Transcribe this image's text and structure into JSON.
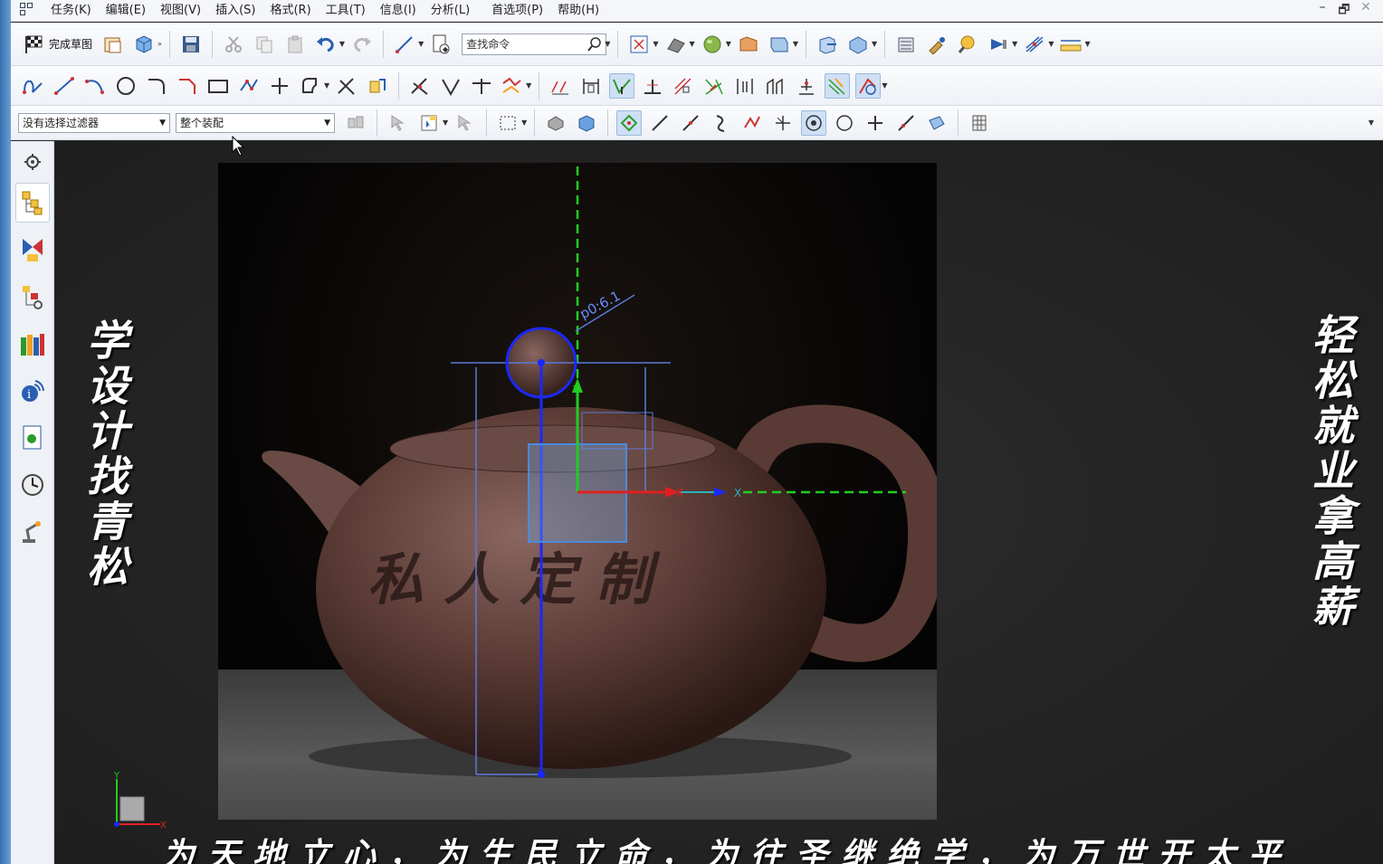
{
  "menu": {
    "items": [
      "任务(K)",
      "编辑(E)",
      "视图(V)",
      "插入(S)",
      "格式(R)",
      "工具(T)",
      "信息(I)",
      "分析(L)",
      "首选项(P)",
      "帮助(H)"
    ]
  },
  "window_controls": {
    "minimize": "–",
    "restore": "🗗",
    "close": "✕"
  },
  "toolbar1": {
    "finish_sketch_label": "完成草图",
    "search_placeholder": "查找命令"
  },
  "toolbar3": {
    "selection_filter": "没有选择过滤器",
    "scope": "整个装配"
  },
  "sketch": {
    "dimension_label": "p0:6.1"
  },
  "overlay_text": {
    "left_vertical": "学设计找青松",
    "right_vertical": "轻松就业拿高薪",
    "bottom_motto": "为天地立心，为生民立命，为往圣继绝学，为万世开太平",
    "pot_inscription": "私人定制"
  },
  "colors": {
    "sketch_blue": "#1a28ff",
    "axis_green": "#22cc22",
    "axis_red": "#e02020",
    "pot_brown": "#5a3a34"
  }
}
